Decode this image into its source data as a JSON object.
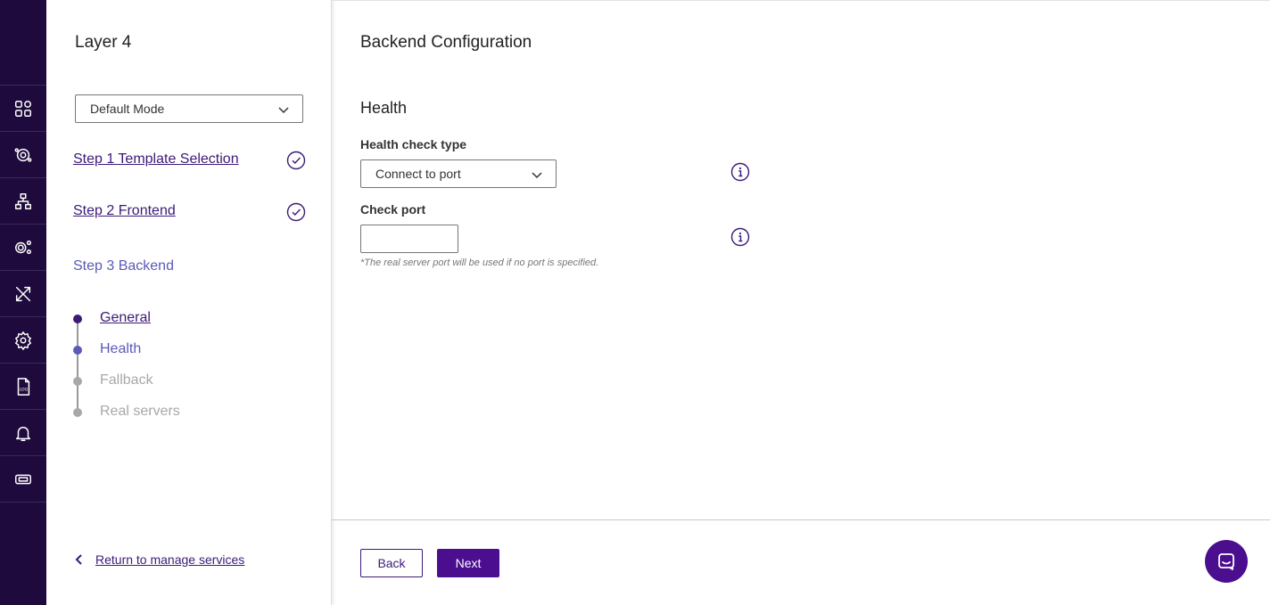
{
  "rail": {
    "items": [
      {
        "icon": "grid-icon"
      },
      {
        "icon": "cog-network-icon"
      },
      {
        "icon": "network-icon"
      },
      {
        "icon": "gears-icon"
      },
      {
        "icon": "tools-icon"
      },
      {
        "icon": "settings-icon"
      },
      {
        "icon": "log-file-icon",
        "label": "LOG"
      },
      {
        "icon": "bell-icon"
      },
      {
        "icon": "ticket-icon"
      }
    ]
  },
  "wizard": {
    "title": "Layer 4",
    "mode": "Default Mode",
    "steps": [
      {
        "label": "Step 1 Template Selection",
        "status": "complete"
      },
      {
        "label": "Step 2 Frontend",
        "status": "complete"
      },
      {
        "label": "Step 3 Backend",
        "status": "current"
      }
    ],
    "substeps": [
      {
        "label": "General",
        "state": "done"
      },
      {
        "label": "Health",
        "state": "current"
      },
      {
        "label": "Fallback",
        "state": "inactive"
      },
      {
        "label": "Real servers",
        "state": "inactive"
      }
    ],
    "return_label": "Return to manage services"
  },
  "main": {
    "title": "Backend Configuration",
    "section": "Health",
    "health_check_type_label": "Health check type",
    "health_check_type_value": "Connect to port",
    "check_port_label": "Check port",
    "check_port_value": "",
    "check_port_hint": "*The real server port will be used if no port is specified.",
    "back_label": "Back",
    "next_label": "Next"
  },
  "colors": {
    "rail_bg": "#1e0a3c",
    "primary": "#4a0e8f",
    "link": "#3c1a78",
    "current": "#5a5ab8",
    "inactive": "#a8a8a8"
  }
}
